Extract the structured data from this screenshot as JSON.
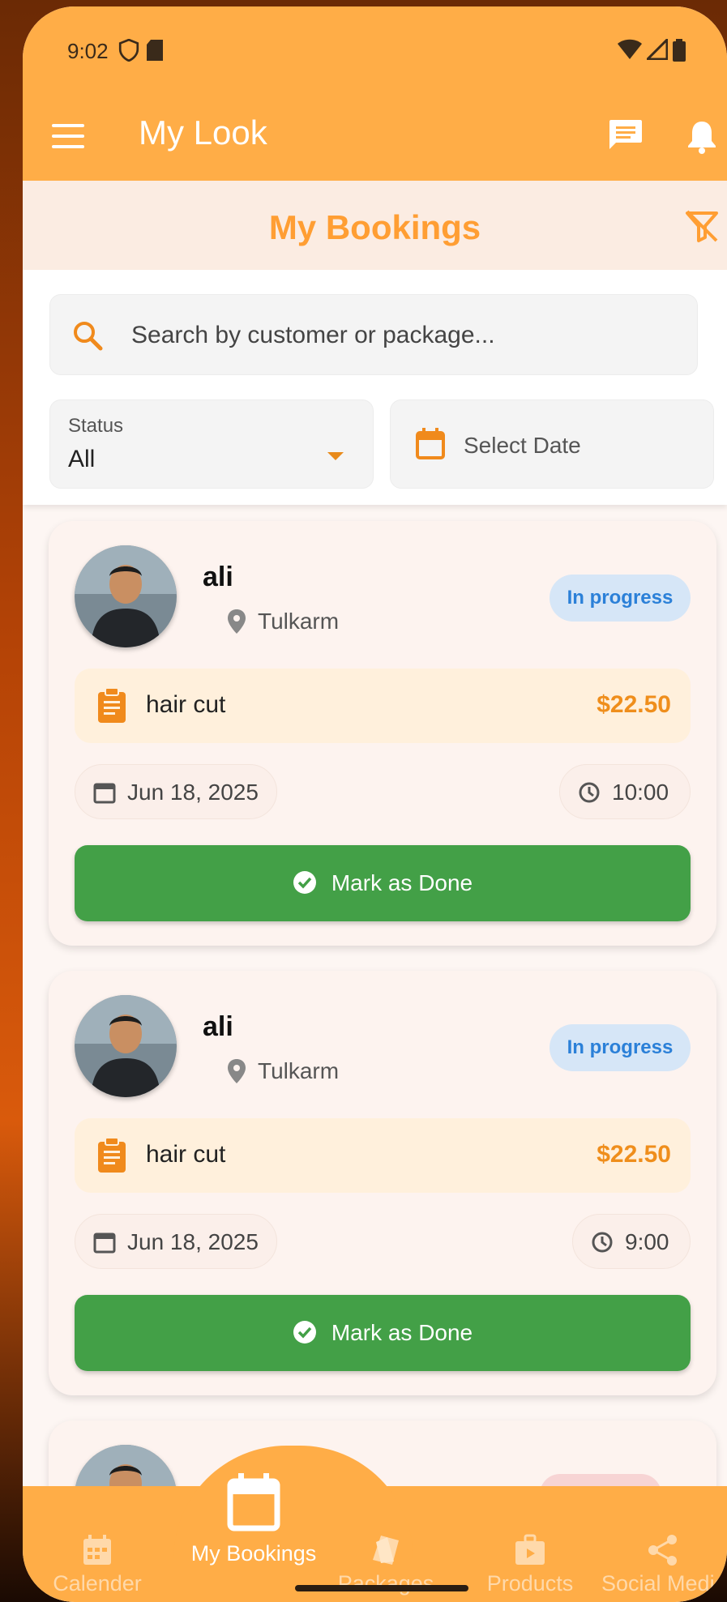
{
  "status_bar": {
    "time": "9:02"
  },
  "app_bar": {
    "title": "My Look"
  },
  "header": {
    "title": "My Bookings"
  },
  "search": {
    "placeholder": "Search by customer or package..."
  },
  "filters": {
    "status_label": "Status",
    "status_value": "All",
    "date_placeholder": "Select Date"
  },
  "bookings": [
    {
      "name": "ali",
      "location": "Tulkarm",
      "status": "In progress",
      "package": "hair cut",
      "price": "$22.50",
      "date": "Jun 18, 2025",
      "time": "10:00",
      "action": "Mark as Done"
    },
    {
      "name": "ali",
      "location": "Tulkarm",
      "status": "In progress",
      "package": "hair cut",
      "price": "$22.50",
      "date": "Jun 18, 2025",
      "time": "9:00",
      "action": "Mark as Done"
    }
  ],
  "bottom_nav": {
    "items": [
      {
        "label": "Calender",
        "icon": "calendar-grid-icon"
      },
      {
        "label": "My Bookings",
        "icon": "calendar-icon",
        "active": true
      },
      {
        "label": "Packages",
        "icon": "tag-icon"
      },
      {
        "label": "Products",
        "icon": "briefcase-icon"
      },
      {
        "label": "Social Media",
        "icon": "share-icon"
      }
    ]
  },
  "colors": {
    "primary": "#ffad47",
    "accent_text": "#ff9e33",
    "done_button": "#43a047",
    "status_badge_bg": "#d6e6f7",
    "status_badge_text": "#2b80d8",
    "price": "#ef8e1c"
  }
}
